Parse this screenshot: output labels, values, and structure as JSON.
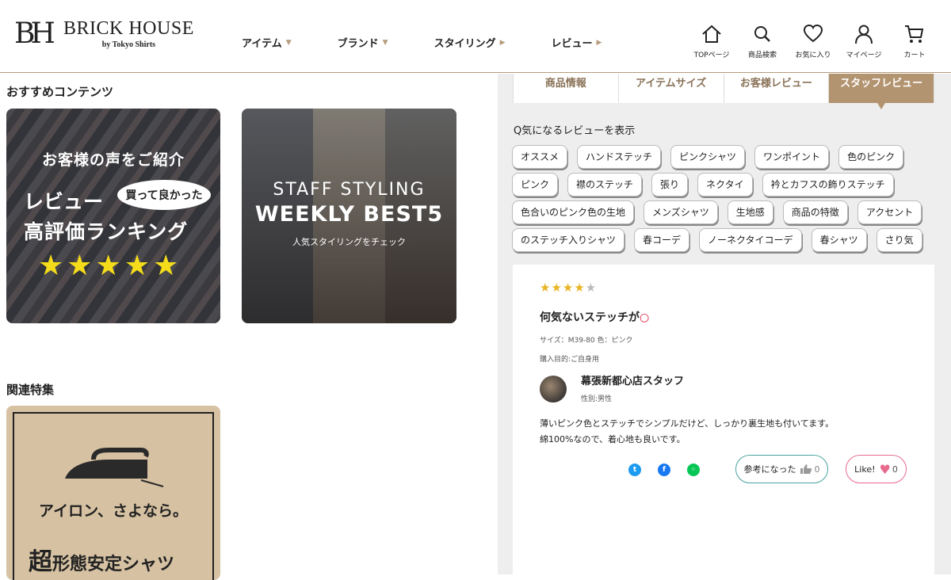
{
  "header": {
    "logo_mark": "BH",
    "brand": "BRICK HOUSE",
    "brand_sub": "by Tokyo Shirts",
    "nav": [
      {
        "label": "アイテム",
        "caret": "▼"
      },
      {
        "label": "ブランド",
        "caret": "▼"
      },
      {
        "label": "スタイリング",
        "caret": "▶"
      },
      {
        "label": "レビュー",
        "caret": "▶"
      }
    ],
    "icons": [
      {
        "name": "home-icon",
        "label": "TOPページ"
      },
      {
        "name": "search-icon",
        "label": "商品検索"
      },
      {
        "name": "heart-icon",
        "label": "お気に入り"
      },
      {
        "name": "user-icon",
        "label": "マイページ"
      },
      {
        "name": "cart-icon",
        "label": "カート"
      }
    ]
  },
  "left": {
    "recommend_title": "おすすめコンテンツ",
    "banner_review": {
      "line1": "お客様の声をご紹介",
      "line2": "レビュー",
      "bubble": "買って良かった",
      "line3": "高評価ランキング",
      "stars": "★★★★★"
    },
    "banner_styling": {
      "line1": "STAFF STYLING",
      "line2": "WEEKLY BEST5",
      "line3": "人気スタイリングをチェック"
    },
    "related_title": "関連特集",
    "banner_iron": {
      "line1": "アイロン、さよなら。",
      "line2_big": "超",
      "line2": "形態安定シャツ"
    }
  },
  "panel": {
    "tabs": [
      {
        "label": "商品情報",
        "active": false
      },
      {
        "label": "アイテムサイズ",
        "active": false
      },
      {
        "label": "お客様レビュー",
        "active": false
      },
      {
        "label": "スタッフレビュー",
        "active": true
      }
    ],
    "filter_label": "Q気になるレビューを表示",
    "tags": [
      "オススメ",
      "ハンドステッチ",
      "ピンクシャツ",
      "ワンポイント",
      "色のピンク",
      "ピンク",
      "襟のステッチ",
      "張り",
      "ネクタイ",
      "衿とカフスの飾りステッチ",
      "色合いのピンク色の生地",
      "メンズシャツ",
      "生地感",
      "商品の特徴",
      "アクセント",
      "のステッチ入りシャツ",
      "春コーデ",
      "ノーネクタイコーデ",
      "春シャツ",
      "さり気"
    ],
    "review": {
      "stars_on": "★★★★",
      "stars_off": "★",
      "rating": 4,
      "title": "何気ないステッチが",
      "title_mark": "○",
      "size": "サイズ：M39-80 色：ピンク",
      "purchase": "購入目的:ご自身用",
      "reviewer": "幕張新都心店スタッフ",
      "gender": "性別:男性",
      "body_line1": "薄いピンク色とステッチでシンプルだけど、しっかり裏生地も付いてます。",
      "body_line2": "綿100%なので、着心地も良いです。",
      "helpful_label": "参考になった",
      "helpful_count": "0",
      "like_label": "Like!",
      "like_count": "0"
    }
  },
  "colors": {
    "accent": "#b39470",
    "tab_text": "#8a7257",
    "star": "#e9b423",
    "helpful_border": "#4aa3a0",
    "like_border": "#e86b8e"
  }
}
